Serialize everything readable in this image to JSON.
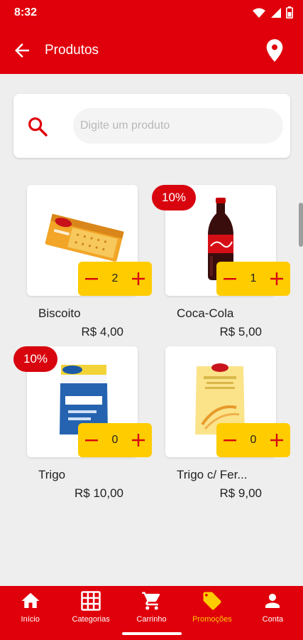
{
  "status_bar": {
    "time": "8:32",
    "icons": [
      "wifi-icon",
      "signal-icon",
      "battery-icon"
    ]
  },
  "app_bar": {
    "title": "Produtos",
    "back_icon": "arrow-left-icon",
    "location_icon": "location-pin-icon"
  },
  "search": {
    "placeholder": "Digite um produto",
    "value": "",
    "icon": "search-icon"
  },
  "products": [
    {
      "name": "Biscoito",
      "price": "R$ 4,00",
      "quantity": "2",
      "discount": "",
      "image": "cracker-package"
    },
    {
      "name": "Coca-Cola",
      "price": "R$ 5,00",
      "quantity": "1",
      "discount": "10%",
      "image": "soda-bottle"
    },
    {
      "name": "Trigo",
      "price": "R$ 10,00",
      "quantity": "0",
      "discount": "10%",
      "image": "flour-bag-blue"
    },
    {
      "name": "Trigo c/ Fer...",
      "price": "R$ 9,00",
      "quantity": "0",
      "discount": "",
      "image": "flour-bag-yellow"
    }
  ],
  "bottom_nav": [
    {
      "label": "Início",
      "icon": "home-icon",
      "active": false
    },
    {
      "label": "Categorias",
      "icon": "grid-icon",
      "active": false
    },
    {
      "label": "Carrinho",
      "icon": "cart-icon",
      "active": false
    },
    {
      "label": "Promoções",
      "icon": "tag-icon",
      "active": true
    },
    {
      "label": "Conta",
      "icon": "person-icon",
      "active": false
    }
  ],
  "colors": {
    "primary": "#e0000b",
    "accent": "#ffcc00",
    "background": "#eeeeee"
  }
}
